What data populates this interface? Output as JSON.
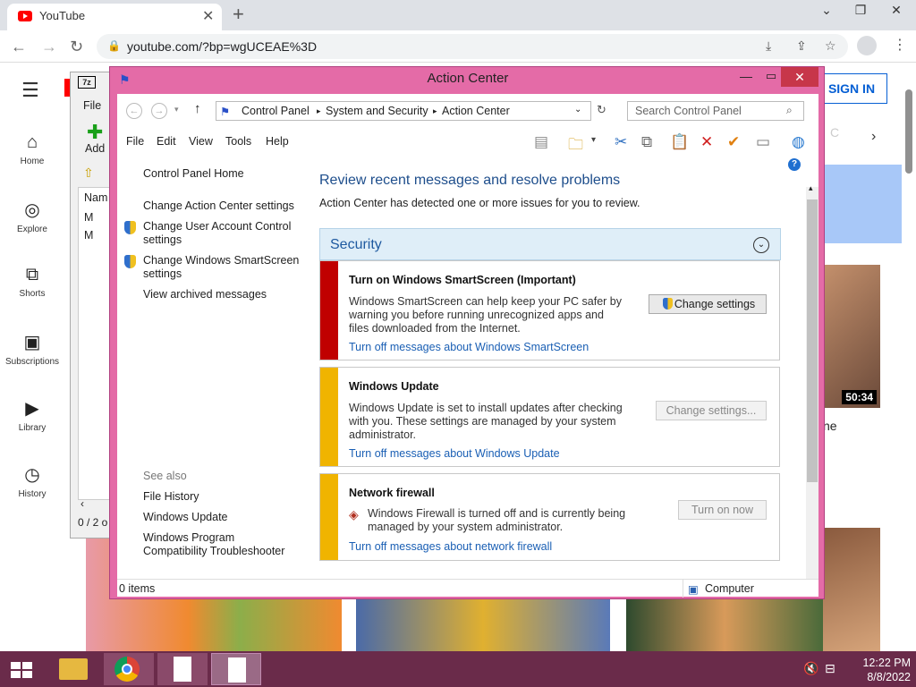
{
  "browser": {
    "tab_title": "YouTube",
    "url": "youtube.com/?bp=wgUCEAE%3D"
  },
  "youtube": {
    "sidebar": [
      {
        "label": "Home",
        "icon": "home-icon"
      },
      {
        "label": "Explore",
        "icon": "compass-icon"
      },
      {
        "label": "Shorts",
        "icon": "shorts-icon"
      },
      {
        "label": "Subscriptions",
        "icon": "subscriptions-icon"
      },
      {
        "label": "Library",
        "icon": "library-icon"
      },
      {
        "label": "History",
        "icon": "history-icon"
      }
    ],
    "sign_in": "SIGN IN",
    "video_duration": "50:34",
    "partial_title": "ne"
  },
  "sevenzip": {
    "logo": "7z",
    "file_menu": "File",
    "add_label": "Add",
    "col_name": "Nam",
    "rows": [
      "M",
      "M"
    ],
    "status": "0 / 2 o"
  },
  "action_center": {
    "title": "Action Center",
    "breadcrumb": [
      "Control Panel",
      "System and Security",
      "Action Center"
    ],
    "search_placeholder": "Search Control Panel",
    "menu": [
      "File",
      "Edit",
      "View",
      "Tools",
      "Help"
    ],
    "left_links": {
      "home": "Control Panel Home",
      "settings": "Change Action Center settings",
      "uac": "Change User Account Control settings",
      "smartscreen": "Change Windows SmartScreen settings",
      "archived": "View archived messages",
      "see_also": "See also",
      "file_history": "File History",
      "windows_update": "Windows Update",
      "compat": "Windows Program Compatibility Troubleshooter"
    },
    "heading": "Review recent messages and resolve problems",
    "subheading": "Action Center has detected one or more issues for you to review.",
    "section": "Security",
    "messages": [
      {
        "title": "Turn on Windows SmartScreen (Important)",
        "body": "Windows SmartScreen can help keep your PC safer by warning you before running unrecognized apps and files downloaded from the Internet.",
        "link": "Turn off messages about Windows SmartScreen",
        "button": "Change settings",
        "color": "#c00000"
      },
      {
        "title": "Windows Update",
        "body": "Windows Update is set to install updates after checking with you.  These settings are managed by your system administrator.",
        "link": "Turn off messages about Windows Update",
        "button": "Change settings...",
        "color": "#f0b400"
      },
      {
        "title": "Network firewall",
        "body": "Windows Firewall is turned off and is currently being managed by your system administrator.",
        "link": "Turn off messages about network firewall",
        "button": "Turn on now",
        "color": "#f0b400"
      }
    ],
    "status_left": "0 items",
    "status_right": "Computer"
  },
  "taskbar": {
    "time": "12:22 PM",
    "date": "8/8/2022"
  }
}
